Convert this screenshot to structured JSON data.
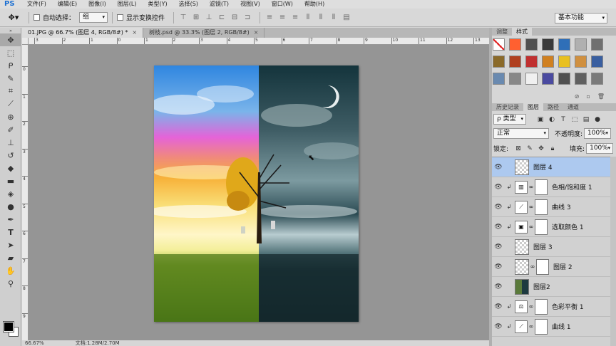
{
  "app": {
    "logo": "PS"
  },
  "menu": [
    "文件(F)",
    "编辑(E)",
    "图像(I)",
    "图层(L)",
    "类型(Y)",
    "选择(S)",
    "滤镜(T)",
    "视图(V)",
    "窗口(W)",
    "帮助(H)"
  ],
  "options": {
    "auto_select_label": "自动选择：",
    "auto_select_value": "组",
    "show_transform_label": "显示变换控件",
    "workspace": "基本功能"
  },
  "tabs": [
    {
      "label": "01.JPG @ 66.7% (图层 4, RGB/8#) *",
      "close": "×"
    },
    {
      "label": "树枝.psd @ 33.3% (图层 2, RGB/8#)",
      "close": "×"
    }
  ],
  "ruler": {
    "top": [
      "3",
      "2",
      "1",
      "0",
      "1",
      "2",
      "3",
      "4",
      "5",
      "6",
      "7",
      "8",
      "9",
      "10",
      "11",
      "12",
      "13",
      "14"
    ],
    "left": [
      "0",
      "1",
      "2",
      "3",
      "4",
      "5",
      "6",
      "7",
      "8",
      "9",
      "1"
    ]
  },
  "status": {
    "zoom": "66.67%",
    "doc": "文档:1.28M/2.70M"
  },
  "panels": {
    "top_tabs": [
      "调整",
      "样式"
    ],
    "layer_tabs": [
      "历史记录",
      "图层",
      "路径",
      "通道"
    ],
    "filter_label": "ρ 类型",
    "blend_mode": "正常",
    "opacity_label": "不透明度:",
    "opacity_value": "100%",
    "lock_label": "锁定:",
    "fill_label": "填充:",
    "fill_value": "100%"
  },
  "styles": [
    "#ffffff",
    "#ff6030",
    "#505050",
    "#3a3a3a",
    "#2f6fb8",
    "#b0b0b0",
    "#707070",
    "#8a6a2a",
    "#b04020",
    "#c03030",
    "#d08020",
    "#e8c020",
    "#d09040",
    "#3a5fa0",
    "#6a8ab0",
    "#888888",
    "#f0f0f0",
    "#4a4aa0",
    "#505050",
    "#606060",
    "#7a7a7a"
  ],
  "layers": [
    {
      "name": "图层 4",
      "type": "pixel",
      "selected": true
    },
    {
      "name": "色相/饱和度 1",
      "type": "adjust",
      "icon": "hue-sat",
      "clipped": true
    },
    {
      "name": "曲线 3",
      "type": "adjust",
      "icon": "curves",
      "clipped": true
    },
    {
      "name": "选取颜色 1",
      "type": "adjust",
      "icon": "selective-color",
      "clipped": true
    },
    {
      "name": "图层 3",
      "type": "pixel"
    },
    {
      "name": "图层 2",
      "type": "masked"
    },
    {
      "name": "图层2",
      "type": "image"
    },
    {
      "name": "色彩平衡 1",
      "type": "adjust",
      "icon": "color-balance",
      "clipped": true
    },
    {
      "name": "曲线 1",
      "type": "adjust",
      "icon": "curves",
      "clipped": true
    }
  ]
}
